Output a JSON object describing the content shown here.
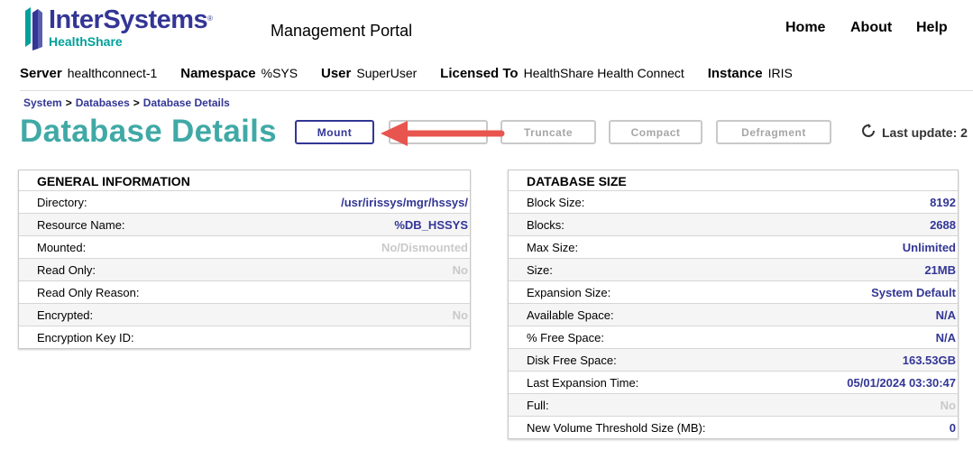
{
  "header": {
    "logo_main": "InterSystems",
    "logo_sub": "HealthShare",
    "portal_title": "Management Portal",
    "nav": [
      "Home",
      "About",
      "Help"
    ]
  },
  "infobar": [
    {
      "key": "Server",
      "value": "healthconnect-1"
    },
    {
      "key": "Namespace",
      "value": "%SYS"
    },
    {
      "key": "User",
      "value": "SuperUser"
    },
    {
      "key": "Licensed To",
      "value": "HealthShare Health Connect"
    },
    {
      "key": "Instance",
      "value": "IRIS"
    }
  ],
  "breadcrumb": [
    "System",
    "Databases",
    "Database Details"
  ],
  "page_title": "Database Details",
  "toolbar": {
    "buttons": [
      {
        "label": "Mount",
        "enabled": true
      },
      {
        "label": "",
        "enabled": false
      },
      {
        "label": "Truncate",
        "enabled": false
      },
      {
        "label": "Compact",
        "enabled": false
      },
      {
        "label": "Defragment",
        "enabled": false
      }
    ],
    "last_update": "Last update: 2"
  },
  "general_information": {
    "title": "GENERAL INFORMATION",
    "rows": [
      {
        "label": "Directory:",
        "value": "/usr/irissys/mgr/hssys/",
        "dim": false
      },
      {
        "label": "Resource Name:",
        "value": "%DB_HSSYS",
        "dim": false
      },
      {
        "label": "Mounted:",
        "value": "No/Dismounted",
        "dim": true
      },
      {
        "label": "Read Only:",
        "value": "No",
        "dim": true
      },
      {
        "label": "Read Only Reason:",
        "value": "",
        "dim": false
      },
      {
        "label": "Encrypted:",
        "value": "No",
        "dim": true
      },
      {
        "label": "Encryption Key ID:",
        "value": "",
        "dim": false
      }
    ]
  },
  "database_size": {
    "title": "DATABASE SIZE",
    "rows": [
      {
        "label": "Block Size:",
        "value": "8192",
        "dim": false
      },
      {
        "label": "Blocks:",
        "value": "2688",
        "dim": false
      },
      {
        "label": "Max Size:",
        "value": "Unlimited",
        "dim": false
      },
      {
        "label": "Size:",
        "value": "21MB",
        "dim": false
      },
      {
        "label": "Expansion Size:",
        "value": "System Default",
        "dim": false
      },
      {
        "label": "Available Space:",
        "value": "N/A",
        "dim": false
      },
      {
        "label": "% Free Space:",
        "value": "N/A",
        "dim": false
      },
      {
        "label": "Disk Free Space:",
        "value": "163.53GB",
        "dim": false
      },
      {
        "label": "Last Expansion Time:",
        "value": "05/01/2024 03:30:47",
        "dim": false
      },
      {
        "label": "Full:",
        "value": "No",
        "dim": true
      },
      {
        "label": "New Volume Threshold Size (MB):",
        "value": "0",
        "dim": false
      }
    ]
  },
  "colors": {
    "brand_blue": "#333695",
    "teal": "#40a9a6",
    "arrow_red": "#e8554e"
  }
}
